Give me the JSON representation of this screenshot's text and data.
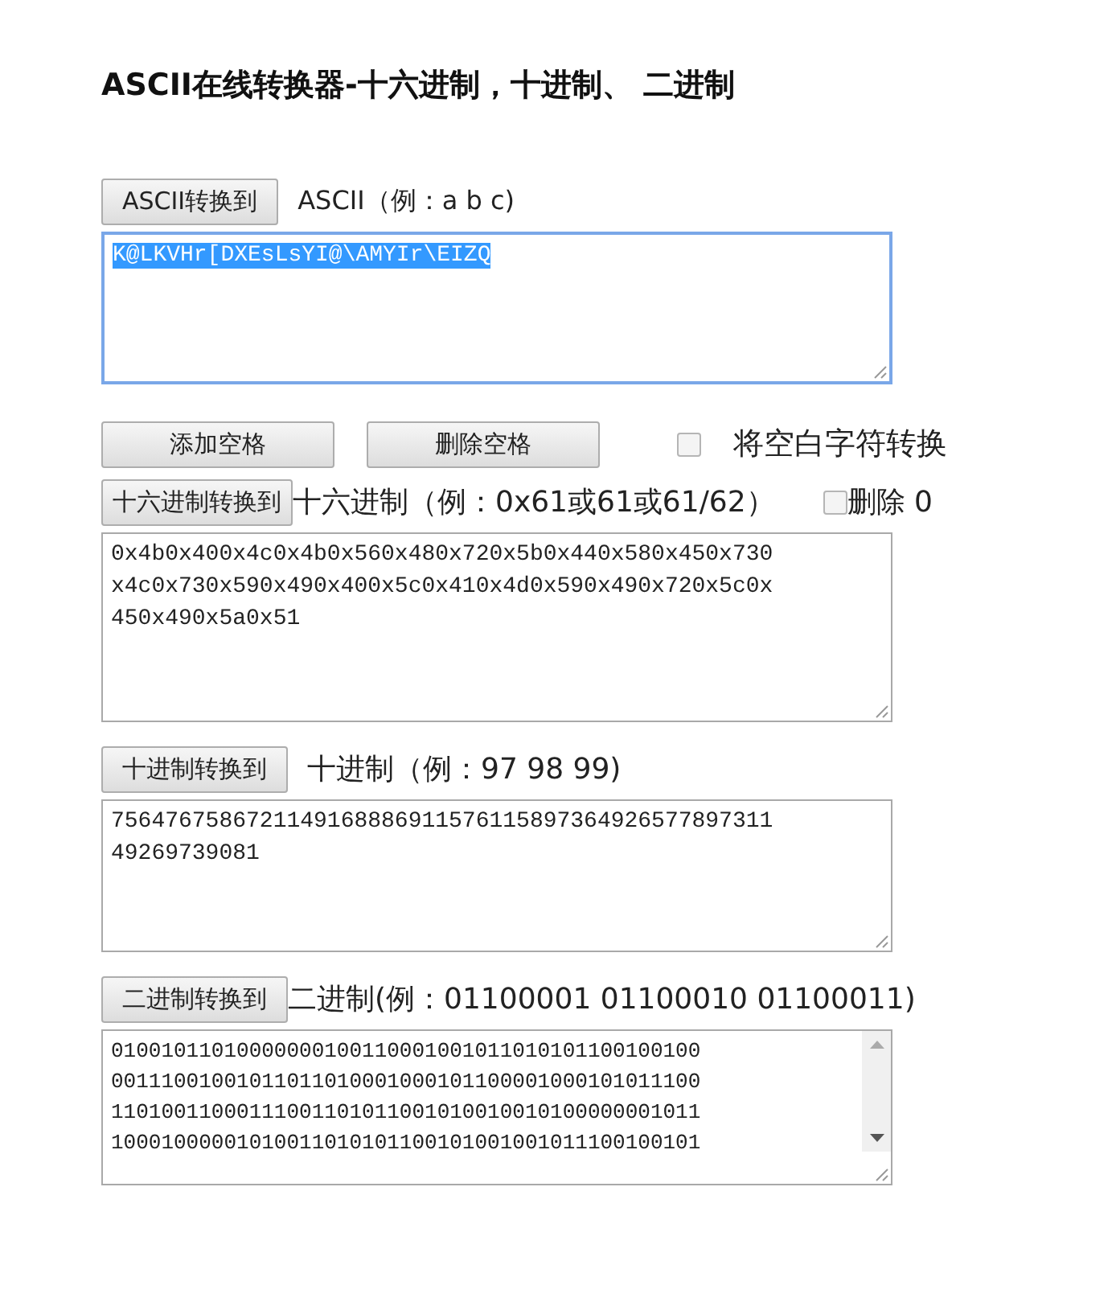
{
  "title": "ASCII在线转换器-十六进制，十进制、 二进制",
  "sections": [
    {
      "kind": "ascii",
      "button": "ASCII转换到",
      "label": "ASCII（例：a b c)",
      "selected_text": true,
      "lines": [
        "K@LKVHr[DXEsLsYI@\\AMYIr\\EIZQ"
      ]
    },
    {
      "kind": "tools",
      "buttons": [
        "添加空格",
        "删除空格"
      ],
      "checkbox": {
        "label": "将空白字符转换",
        "checked": false
      }
    },
    {
      "kind": "hex",
      "button": "十六进制转换到",
      "label": "十六进制（例：0x61或61或61/62）",
      "checkbox": {
        "label": "删除 0",
        "checked": false
      },
      "lines": [
        "0x4b0x400x4c0x4b0x560x480x720x5b0x440x580x450x730",
        "x4c0x730x590x490x400x5c0x410x4d0x590x490x720x5c0x",
        "450x490x5a0x51"
      ]
    },
    {
      "kind": "decimal",
      "button": "十进制转换到",
      "label": "十进制（例：97 98 99)",
      "lines": [
        "7564767586721149168886911576115897364926577897311",
        "49269739081"
      ]
    },
    {
      "kind": "binary",
      "button": "二进制转换到",
      "label": "二进制(例：01100001 01100010 01100011)",
      "lines": [
        "01001011010000000100110001001011010101100100100",
        "00111001001011011010001000101100001000101011100",
        "11010011000111001101011001010010010100000001011",
        "10001000001010011010101100101001001011100100101"
      ]
    }
  ]
}
